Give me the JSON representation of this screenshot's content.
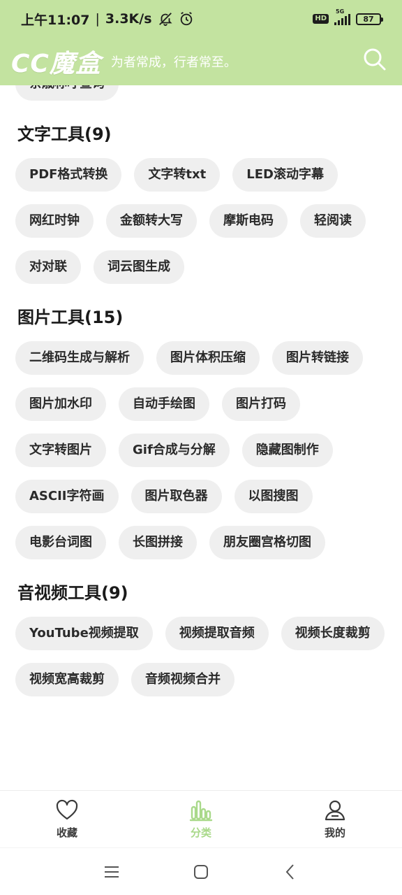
{
  "status_bar": {
    "time": "上午11:07",
    "separator": "|",
    "speed": "3.3K/s",
    "hd": "HD",
    "network": "5G",
    "battery": "87"
  },
  "app_bar": {
    "logo": "CC魔盒",
    "slogan": "为者常成，行者常至。"
  },
  "partial_chip": "亲戚称呼查询",
  "sections": [
    {
      "title": "文字工具(9)",
      "items": [
        "PDF格式转换",
        "文字转txt",
        "LED滚动字幕",
        "网红时钟",
        "金额转大写",
        "摩斯电码",
        "轻阅读",
        "对对联",
        "词云图生成"
      ]
    },
    {
      "title": "图片工具(15)",
      "items": [
        "二维码生成与解析",
        "图片体积压缩",
        "图片转链接",
        "图片加水印",
        "自动手绘图",
        "图片打码",
        "文字转图片",
        "Gif合成与分解",
        "隐藏图制作",
        "ASCII字符画",
        "图片取色器",
        "以图搜图",
        "电影台词图",
        "长图拼接",
        "朋友圈宫格切图"
      ]
    },
    {
      "title": "音视频工具(9)",
      "items": [
        "YouTube视频提取",
        "视频提取音频",
        "视频长度裁剪",
        "视频宽高裁剪",
        "音频视频合并"
      ]
    }
  ],
  "bottom_nav": {
    "favorites": "收藏",
    "categories": "分类",
    "mine": "我的"
  },
  "colors": {
    "header_bg": "#c3e3a0",
    "accent": "#a9d98a",
    "chip_bg": "#efefef"
  }
}
